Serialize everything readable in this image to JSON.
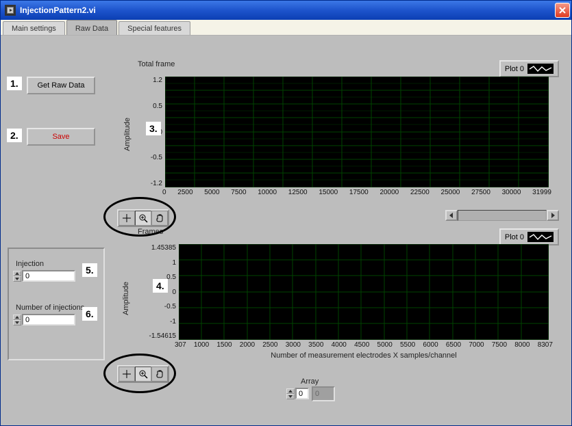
{
  "window": {
    "title": "InjectionPattern2.vi"
  },
  "tabs": {
    "items": [
      {
        "label": "Main settings"
      },
      {
        "label": "Raw Data"
      },
      {
        "label": "Special features"
      }
    ],
    "active": 1
  },
  "buttons": {
    "get_raw_data": "Get Raw Data",
    "save": "Save"
  },
  "colors": {
    "save_text": "#c00000"
  },
  "panel": {
    "injection_label": "Injection",
    "injection_value": "0",
    "num_injections_label": "Number of injections",
    "num_injections_value": "0"
  },
  "chart1": {
    "title": "Total frame",
    "legend": "Plot 0",
    "ylabel": "Amplitude",
    "yticks": [
      "1.2",
      "0.5",
      "0",
      "-0.5",
      "-1.2"
    ],
    "xticks": [
      "0",
      "2500",
      "5000",
      "7500",
      "10000",
      "12500",
      "15000",
      "17500",
      "20000",
      "22500",
      "25000",
      "27500",
      "30000",
      "31999"
    ]
  },
  "chart2": {
    "title": "Frames",
    "legend": "Plot 0",
    "ylabel": "Amplitude",
    "xlabel": "Number of measurement electrodes X samples/channel",
    "yticks": [
      "1.45385",
      "1",
      "0.5",
      "0",
      "-0.5",
      "-1",
      "-1.54615"
    ],
    "xticks": [
      "307",
      "1000",
      "1500",
      "2000",
      "2500",
      "3000",
      "3500",
      "4000",
      "4500",
      "5000",
      "5500",
      "6000",
      "6500",
      "7000",
      "7500",
      "8000",
      "8307"
    ]
  },
  "array": {
    "label": "Array",
    "index": "0",
    "value": "0"
  },
  "callouts": {
    "c1": "1.",
    "c2": "2.",
    "c3": "3.",
    "c4": "4.",
    "c5": "5.",
    "c6": "6."
  },
  "chart_data": [
    {
      "type": "line",
      "title": "Total frame",
      "xlabel": "",
      "ylabel": "Amplitude",
      "xlim": [
        0,
        31999
      ],
      "ylim": [
        -1.2,
        1.2
      ],
      "series": [
        {
          "name": "Plot 0",
          "x": [
            0,
            31999
          ],
          "values": [
            0,
            0
          ]
        }
      ]
    },
    {
      "type": "line",
      "title": "Frames",
      "xlabel": "Number of measurement electrodes X samples/channel",
      "ylabel": "Amplitude",
      "xlim": [
        307,
        8307
      ],
      "ylim": [
        -1.54615,
        1.45385
      ],
      "series": [
        {
          "name": "Plot 0",
          "x": [
            307,
            8307
          ],
          "values": [
            0,
            0
          ]
        }
      ]
    }
  ]
}
